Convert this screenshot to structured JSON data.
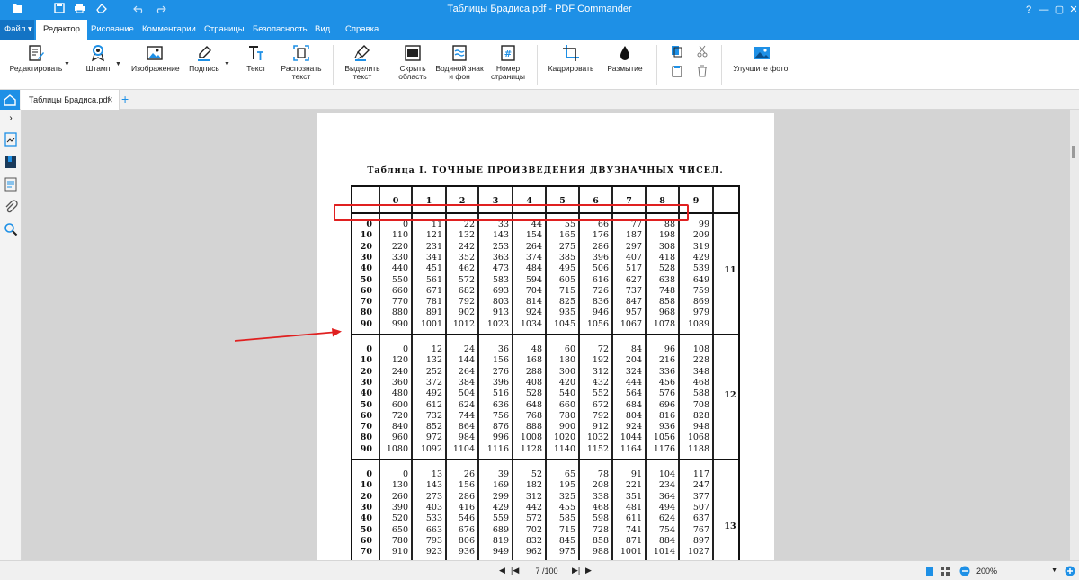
{
  "window": {
    "title": "Таблицы Брадиса.pdf - PDF Commander"
  },
  "menu": {
    "file": "Файл",
    "tabs": [
      "Редактор",
      "Рисование",
      "Комментарии",
      "Страницы",
      "Безопасность",
      "Вид",
      "Справка"
    ]
  },
  "ribbon": {
    "edit": "Редактировать",
    "stamp": "Штамп",
    "image": "Изображение",
    "signature": "Подпись",
    "text": "Текст",
    "recognize_l1": "Распознать",
    "recognize_l2": "текст",
    "highlight_l1": "Выделить",
    "highlight_l2": "текст",
    "hide_l1": "Скрыть",
    "hide_l2": "область",
    "watermark_l1": "Водяной знак",
    "watermark_l2": "и фон",
    "pagenum_l1": "Номер",
    "pagenum_l2": "страницы",
    "crop": "Кадрировать",
    "blur": "Размытие",
    "enhance": "Улучшите фото!"
  },
  "doc_tab": {
    "name": "Таблицы Брадиса.pdf"
  },
  "document": {
    "title": "Таблица I. ТОЧНЫЕ ПРОИЗВЕДЕНИЯ ДВУЗНАЧНЫХ ЧИСЕЛ.",
    "headers": [
      "0",
      "1",
      "2",
      "3",
      "4",
      "5",
      "6",
      "7",
      "8",
      "9"
    ],
    "blocks": [
      {
        "label": "11",
        "rows": [
          {
            "r": "0",
            "v": [
              "0",
              "11",
              "22",
              "33",
              "44",
              "55",
              "66",
              "77",
              "88",
              "99"
            ]
          },
          {
            "r": "10",
            "v": [
              "110",
              "121",
              "132",
              "143",
              "154",
              "165",
              "176",
              "187",
              "198",
              "209"
            ]
          },
          {
            "r": "20",
            "v": [
              "220",
              "231",
              "242",
              "253",
              "264",
              "275",
              "286",
              "297",
              "308",
              "319"
            ]
          },
          {
            "r": "30",
            "v": [
              "330",
              "341",
              "352",
              "363",
              "374",
              "385",
              "396",
              "407",
              "418",
              "429"
            ]
          },
          {
            "r": "40",
            "v": [
              "440",
              "451",
              "462",
              "473",
              "484",
              "495",
              "506",
              "517",
              "528",
              "539"
            ]
          },
          {
            "r": "50",
            "v": [
              "550",
              "561",
              "572",
              "583",
              "594",
              "605",
              "616",
              "627",
              "638",
              "649"
            ]
          },
          {
            "r": "60",
            "v": [
              "660",
              "671",
              "682",
              "693",
              "704",
              "715",
              "726",
              "737",
              "748",
              "759"
            ]
          },
          {
            "r": "70",
            "v": [
              "770",
              "781",
              "792",
              "803",
              "814",
              "825",
              "836",
              "847",
              "858",
              "869"
            ]
          },
          {
            "r": "80",
            "v": [
              "880",
              "891",
              "902",
              "913",
              "924",
              "935",
              "946",
              "957",
              "968",
              "979"
            ]
          },
          {
            "r": "90",
            "v": [
              "990",
              "1001",
              "1012",
              "1023",
              "1034",
              "1045",
              "1056",
              "1067",
              "1078",
              "1089"
            ]
          }
        ]
      },
      {
        "label": "12",
        "rows": [
          {
            "r": "0",
            "v": [
              "0",
              "12",
              "24",
              "36",
              "48",
              "60",
              "72",
              "84",
              "96",
              "108"
            ]
          },
          {
            "r": "10",
            "v": [
              "120",
              "132",
              "144",
              "156",
              "168",
              "180",
              "192",
              "204",
              "216",
              "228"
            ]
          },
          {
            "r": "20",
            "v": [
              "240",
              "252",
              "264",
              "276",
              "288",
              "300",
              "312",
              "324",
              "336",
              "348"
            ]
          },
          {
            "r": "30",
            "v": [
              "360",
              "372",
              "384",
              "396",
              "408",
              "420",
              "432",
              "444",
              "456",
              "468"
            ]
          },
          {
            "r": "40",
            "v": [
              "480",
              "492",
              "504",
              "516",
              "528",
              "540",
              "552",
              "564",
              "576",
              "588"
            ]
          },
          {
            "r": "50",
            "v": [
              "600",
              "612",
              "624",
              "636",
              "648",
              "660",
              "672",
              "684",
              "696",
              "708"
            ]
          },
          {
            "r": "60",
            "v": [
              "720",
              "732",
              "744",
              "756",
              "768",
              "780",
              "792",
              "804",
              "816",
              "828"
            ]
          },
          {
            "r": "70",
            "v": [
              "840",
              "852",
              "864",
              "876",
              "888",
              "900",
              "912",
              "924",
              "936",
              "948"
            ]
          },
          {
            "r": "80",
            "v": [
              "960",
              "972",
              "984",
              "996",
              "1008",
              "1020",
              "1032",
              "1044",
              "1056",
              "1068"
            ]
          },
          {
            "r": "90",
            "v": [
              "1080",
              "1092",
              "1104",
              "1116",
              "1128",
              "1140",
              "1152",
              "1164",
              "1176",
              "1188"
            ]
          }
        ]
      },
      {
        "label": "13",
        "rows": [
          {
            "r": "0",
            "v": [
              "0",
              "13",
              "26",
              "39",
              "52",
              "65",
              "78",
              "91",
              "104",
              "117"
            ]
          },
          {
            "r": "10",
            "v": [
              "130",
              "143",
              "156",
              "169",
              "182",
              "195",
              "208",
              "221",
              "234",
              "247"
            ]
          },
          {
            "r": "20",
            "v": [
              "260",
              "273",
              "286",
              "299",
              "312",
              "325",
              "338",
              "351",
              "364",
              "377"
            ]
          },
          {
            "r": "30",
            "v": [
              "390",
              "403",
              "416",
              "429",
              "442",
              "455",
              "468",
              "481",
              "494",
              "507"
            ]
          },
          {
            "r": "40",
            "v": [
              "520",
              "533",
              "546",
              "559",
              "572",
              "585",
              "598",
              "611",
              "624",
              "637"
            ]
          },
          {
            "r": "50",
            "v": [
              "650",
              "663",
              "676",
              "689",
              "702",
              "715",
              "728",
              "741",
              "754",
              "767"
            ]
          },
          {
            "r": "60",
            "v": [
              "780",
              "793",
              "806",
              "819",
              "832",
              "845",
              "858",
              "871",
              "884",
              "897"
            ]
          },
          {
            "r": "70",
            "v": [
              "910",
              "923",
              "936",
              "949",
              "962",
              "975",
              "988",
              "1001",
              "1014",
              "1027"
            ]
          }
        ]
      }
    ]
  },
  "status": {
    "page_current": "7",
    "page_total": "/100",
    "zoom": "200%"
  },
  "colors": {
    "accent": "#1e90e6",
    "highlight": "#e02020"
  }
}
